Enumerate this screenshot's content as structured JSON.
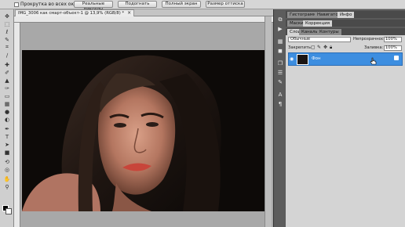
{
  "options_bar": {
    "scroll_all_label": "Прокрутка во всех окнах",
    "buttons": [
      "Реальные пикселы",
      "Подогнать",
      "Полный экран",
      "Размер оттиска"
    ]
  },
  "document": {
    "tab_title": "IMG_3006 как смарт-объект-1 @ 13,9% (RGB/8) *",
    "close_glyph": "×"
  },
  "panels": {
    "top_tabs": [
      "Гистограмма",
      "Навигатор",
      "Инфо"
    ],
    "mid_tabs": [
      "Маски",
      "Коррекция"
    ],
    "layer_tabs": [
      "Слои",
      "Каналы",
      "Контуры"
    ],
    "blend_mode": "Обычные",
    "opacity_label": "Непрозрачность:",
    "opacity_value": "100%",
    "lock_label": "Закрепить:",
    "fill_label": "Заливка:",
    "fill_value": "100%",
    "layer_name": "Фон"
  },
  "colors": {
    "selection_blue": "#3d8ee0",
    "panel_bg": "#d4d4d4",
    "workspace_bg": "#a8a8a8"
  }
}
